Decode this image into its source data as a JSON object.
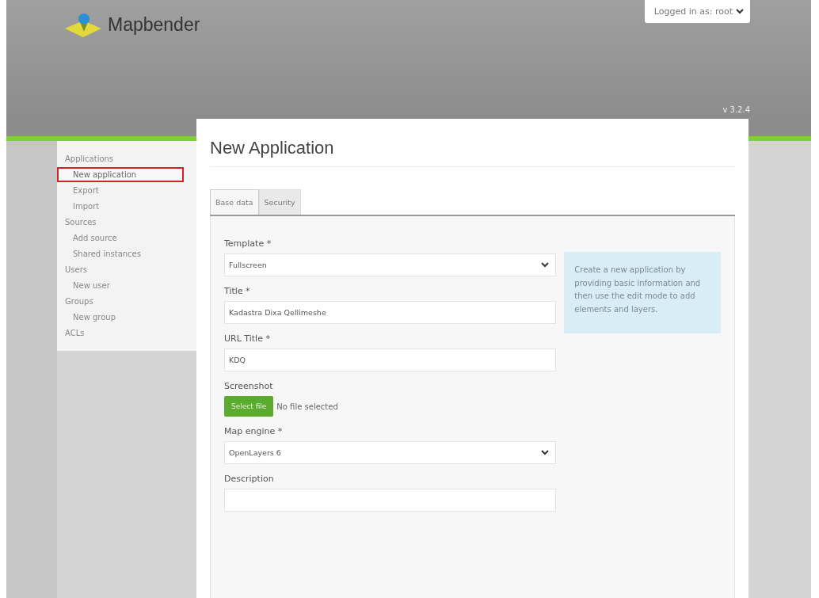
{
  "header": {
    "brand": "Mapbender",
    "user_menu": "Logged in as: root",
    "version": "v 3.2.4"
  },
  "sidebar": {
    "items": [
      {
        "label": "Applications",
        "selected": false,
        "children": [
          {
            "label": "New application",
            "selected": true
          },
          {
            "label": "Export",
            "selected": false
          },
          {
            "label": "Import",
            "selected": false
          }
        ]
      },
      {
        "label": "Sources",
        "selected": false,
        "children": [
          {
            "label": "Add source",
            "selected": false
          },
          {
            "label": "Shared instances",
            "selected": false
          }
        ]
      },
      {
        "label": "Users",
        "selected": false,
        "children": [
          {
            "label": "New user",
            "selected": false
          }
        ]
      },
      {
        "label": "Groups",
        "selected": false,
        "children": [
          {
            "label": "New group",
            "selected": false
          }
        ]
      },
      {
        "label": "ACLs",
        "selected": false
      }
    ]
  },
  "page_title": "New Application",
  "tabs": [
    {
      "label": "Base data",
      "selected": true
    },
    {
      "label": "Security",
      "selected": false
    }
  ],
  "form": {
    "fields": [
      {
        "kind": "select",
        "label": "Template *",
        "value": "Fullscreen"
      },
      {
        "kind": "text",
        "label": "Title *",
        "value": "Kadastra Dixa Qellimeshe"
      },
      {
        "kind": "text",
        "label": "URL Title *",
        "value": "KDQ"
      },
      {
        "kind": "file",
        "label": "Screenshot",
        "button": "Select file",
        "status": "No file selected"
      },
      {
        "kind": "select",
        "label": "Map engine *",
        "value": "OpenLayers 6"
      },
      {
        "kind": "textarea",
        "label": "Description"
      }
    ]
  },
  "help_text": "Create a new application by providing basic information and then use the edit mode to add elements and layers."
}
